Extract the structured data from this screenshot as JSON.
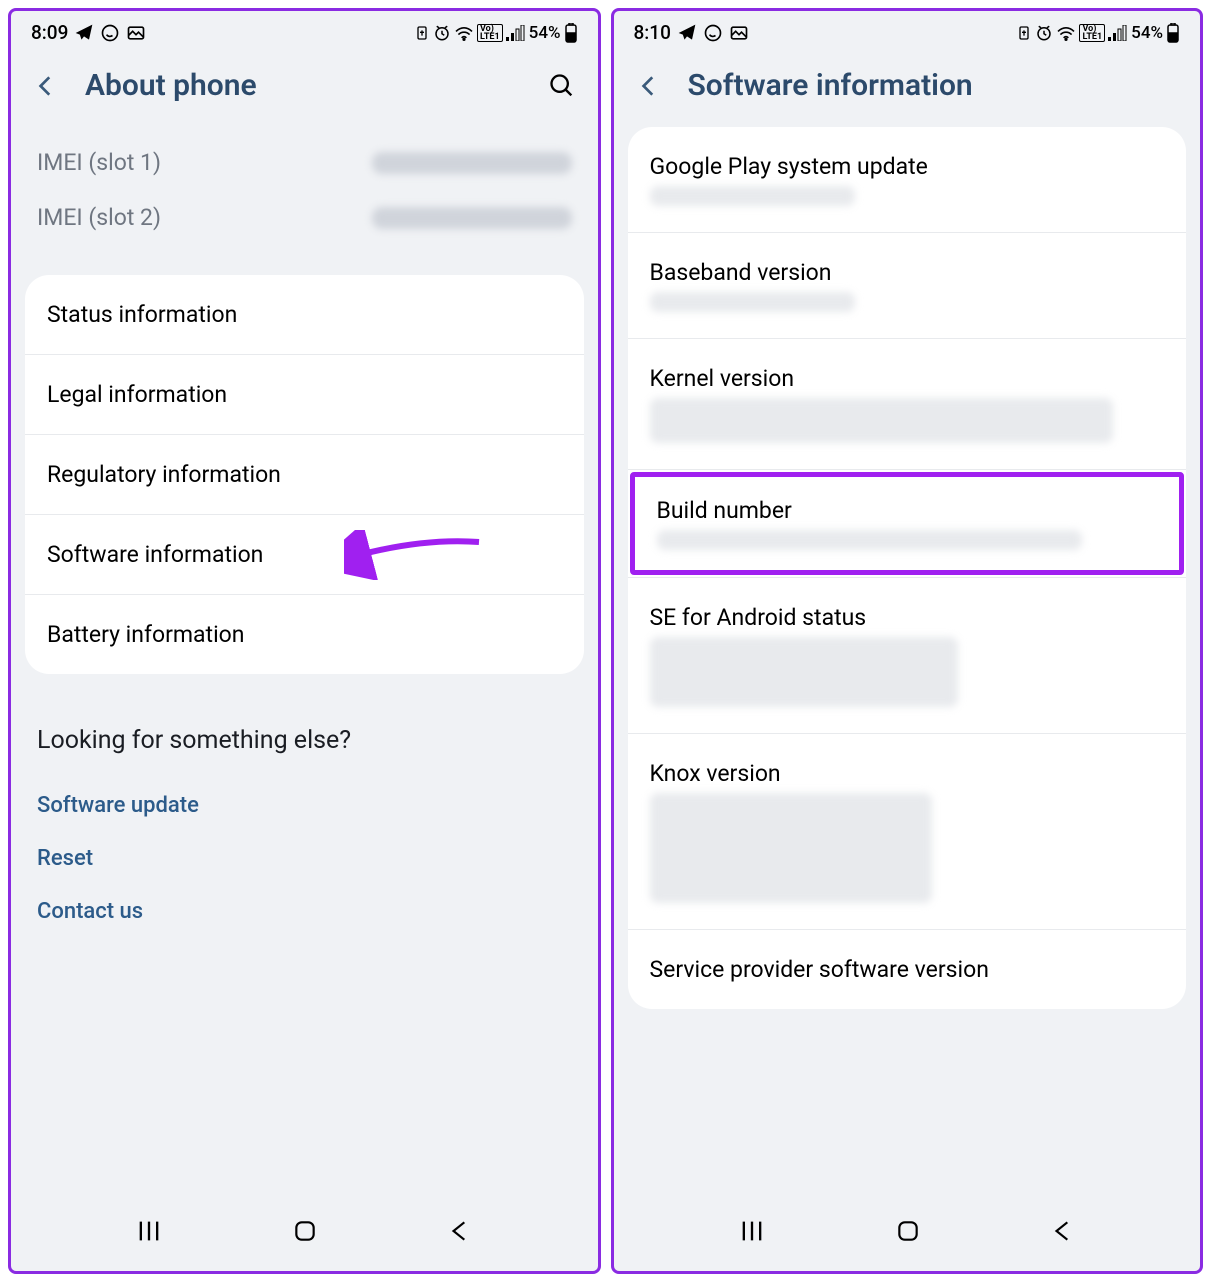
{
  "left": {
    "status": {
      "time": "8:09",
      "battery": "54%"
    },
    "header": {
      "title": "About phone"
    },
    "imei": [
      {
        "label": "IMEI (slot 1)"
      },
      {
        "label": "IMEI (slot 2)"
      }
    ],
    "rows": [
      {
        "title": "Status information"
      },
      {
        "title": "Legal information"
      },
      {
        "title": "Regulatory information"
      },
      {
        "title": "Software information"
      },
      {
        "title": "Battery information"
      }
    ],
    "footer": {
      "title": "Looking for something else?",
      "links": [
        {
          "label": "Software update"
        },
        {
          "label": "Reset"
        },
        {
          "label": "Contact us"
        }
      ]
    }
  },
  "right": {
    "status": {
      "time": "8:10",
      "battery": "54%"
    },
    "header": {
      "title": "Software information"
    },
    "rows": [
      {
        "title": "Google Play system update"
      },
      {
        "title": "Baseband version"
      },
      {
        "title": "Kernel version"
      },
      {
        "title": "Build number",
        "hl": true
      },
      {
        "title": "SE for Android status"
      },
      {
        "title": "Knox version"
      },
      {
        "title": "Service provider software version"
      }
    ]
  }
}
